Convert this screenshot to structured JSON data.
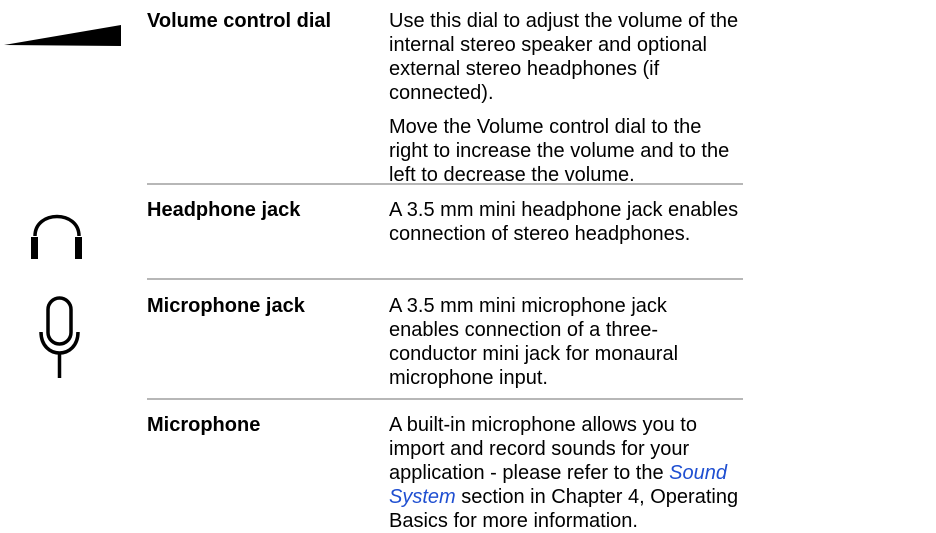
{
  "rows": [
    {
      "icon": "volume-wedge-icon",
      "term": "Volume control dial",
      "paragraphs": [
        "Use this dial to adjust the volume of the internal stereo speaker and optional external stereo headphones (if connected).",
        "Move the Volume control dial to the right to increase the volume and to the left to decrease the volume."
      ]
    },
    {
      "icon": "headphones-icon",
      "term": "Headphone jack",
      "paragraphs": [
        "A 3.5 mm mini headphone jack enables connection of stereo headphones."
      ]
    },
    {
      "icon": "microphone-icon",
      "term": "Microphone jack",
      "paragraphs": [
        "A 3.5 mm mini microphone jack enables connection of a three-conductor mini jack for monaural microphone input."
      ]
    },
    {
      "term": "Microphone",
      "desc_before": "A built-in microphone allows you to import and record sounds for your application - please refer to the",
      "link_text": "Sound System",
      "desc_after": "section in Chapter 4, Operating Basics for more information."
    }
  ],
  "colors": {
    "text": "#000000",
    "divider": "#b7b7b7",
    "link": "#1f4fd1"
  }
}
